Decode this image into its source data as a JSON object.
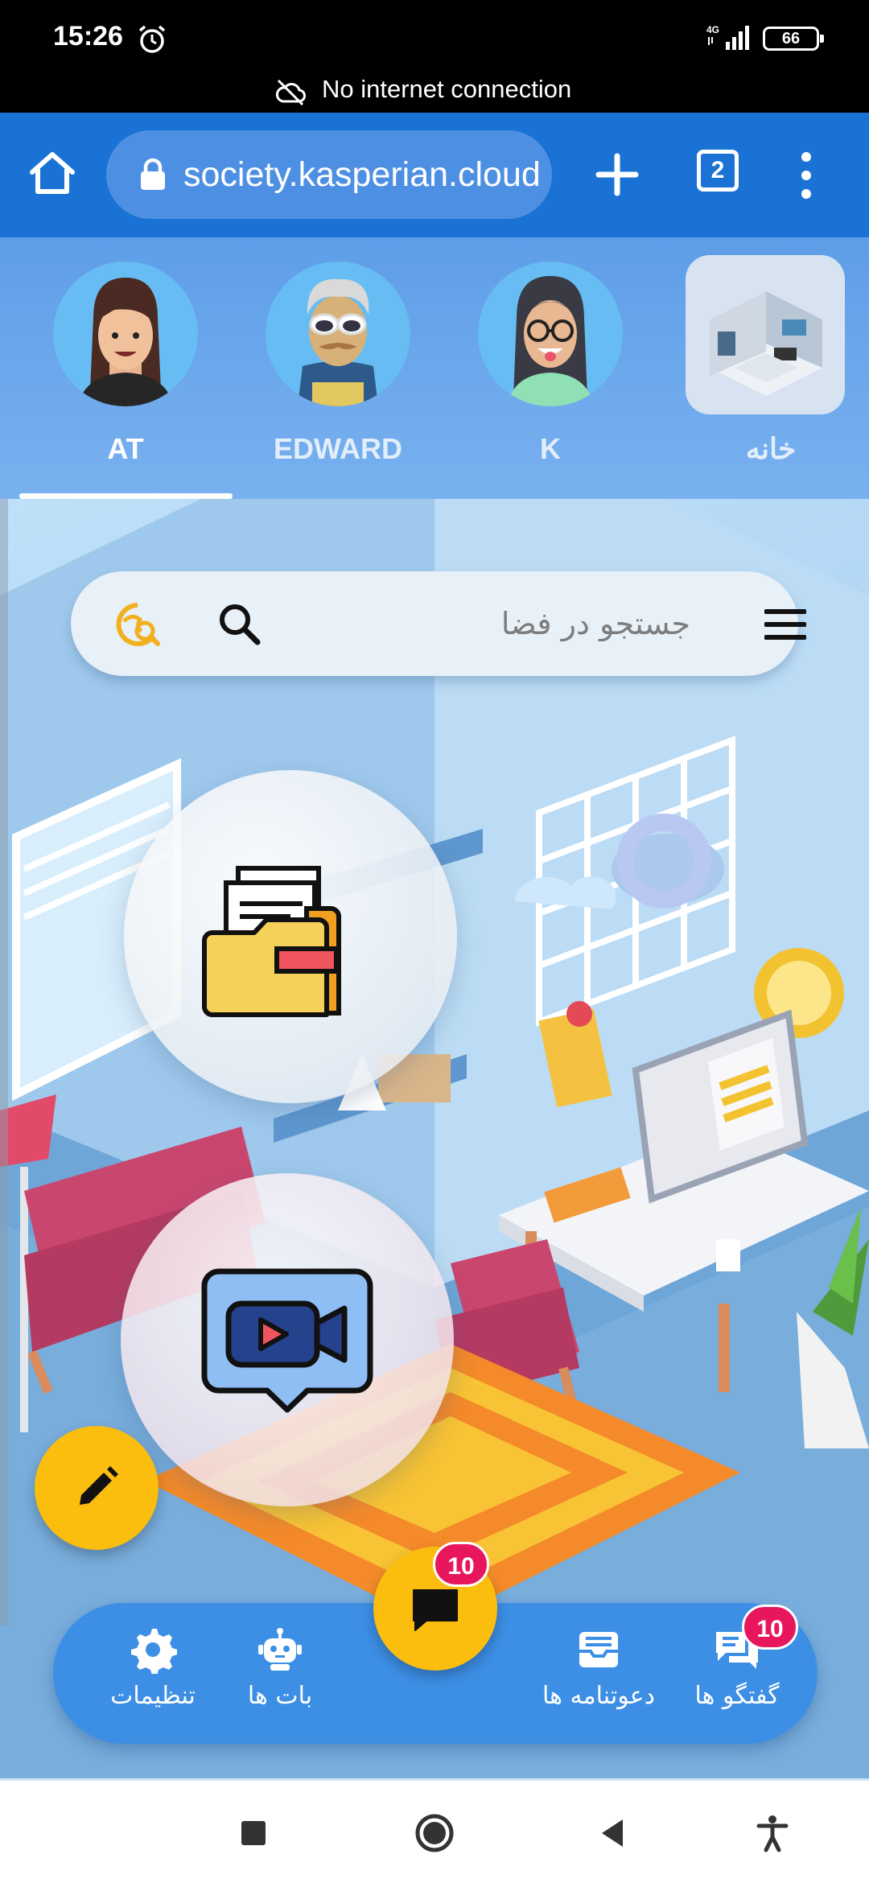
{
  "status_bar": {
    "time": "15:26",
    "network": "4G",
    "battery": "66",
    "offline_message": "No internet connection"
  },
  "browser": {
    "url": "society.kasperian.cloud",
    "tab_count": "2"
  },
  "avatars": {
    "active_index": 0,
    "items": [
      {
        "label": "AT"
      },
      {
        "label": "EDWARD"
      },
      {
        "label": "K"
      },
      {
        "label": "خانه"
      }
    ]
  },
  "search": {
    "placeholder": "جستجو در فضا"
  },
  "bottom_nav": {
    "settings_label": "تنظیمات",
    "bots_label": "بات ها",
    "invites_label": "دعوتنامه ها",
    "chats_label": "گفتگو ها",
    "chats_badge": "10",
    "fab_chat_badge": "10"
  },
  "colors": {
    "toolbar_blue": "#1a73d4",
    "nav_blue": "#3d8fe6",
    "fab_yellow": "#fbbd0e",
    "badge_pink": "#e8175d"
  }
}
